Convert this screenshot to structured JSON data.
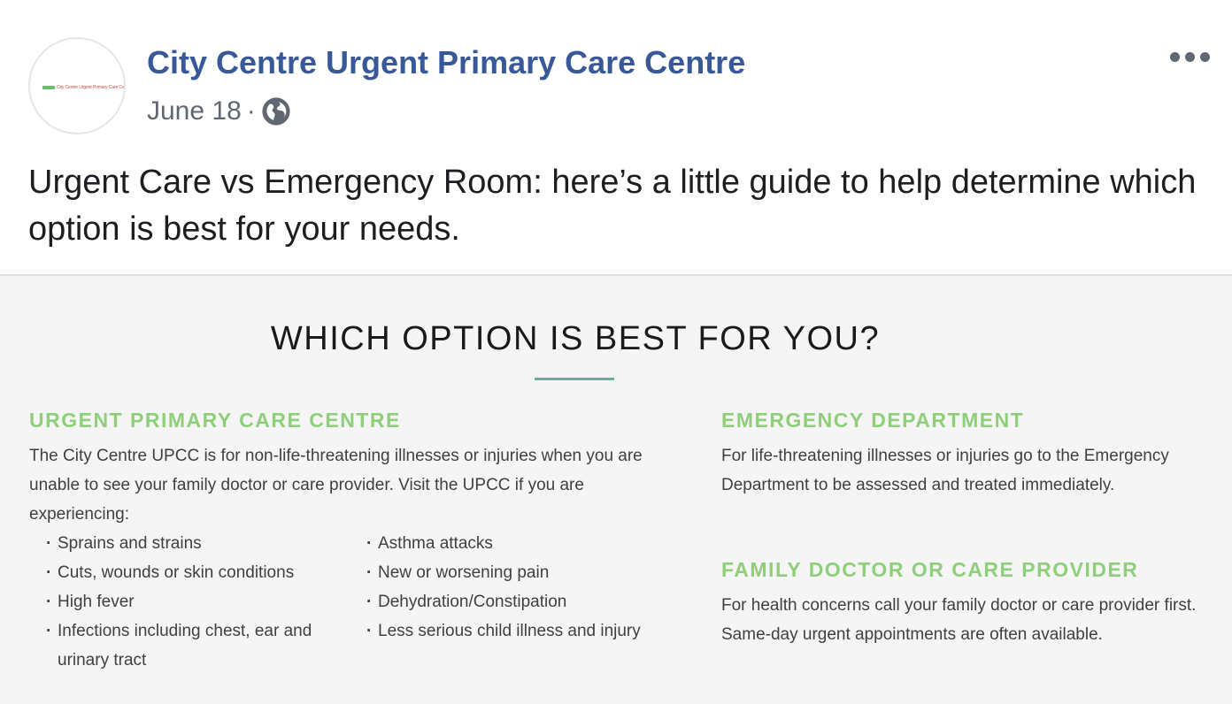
{
  "post": {
    "page_name": "City Centre Urgent Primary Care Centre",
    "avatar_text": "City Centre Urgent Primary Care Centre",
    "date": "June 18",
    "separator": "·",
    "privacy_icon": "globe-icon",
    "more_icon": "ellipsis-icon",
    "caption": "Urgent Care vs Emergency Room: here’s a little guide to help determine which option is best for your needs."
  },
  "infographic": {
    "title": "WHICH OPTION IS BEST FOR YOU?",
    "upcc": {
      "heading": "URGENT PRIMARY CARE CENTRE",
      "body": "The City Centre UPCC is for non-life-threatening illnesses or injuries when you are unable to see your family doctor or care provider. Visit the UPCC if you are experiencing:",
      "bullets_left": [
        "Sprains and strains",
        "Cuts, wounds or skin conditions",
        "High fever",
        "Infections including chest, ear and urinary tract"
      ],
      "bullets_right": [
        "Asthma attacks",
        "New or worsening pain",
        "Dehydration/Constipation",
        "Less serious child illness and injury"
      ]
    },
    "emergency": {
      "heading": "EMERGENCY DEPARTMENT",
      "body": "For life-threatening illnesses or injuries go to the Emergency Department to be assessed and treated immediately."
    },
    "family_doctor": {
      "heading": "FAMILY DOCTOR OR CARE PROVIDER",
      "body": "For health concerns call your family doctor or care provider first. Same-day urgent appointments are often available."
    }
  },
  "colors": {
    "page_name": "#385898",
    "heading_green": "#8fcf7c",
    "title_rule": "#5fb4a0",
    "infographic_bg": "#f5f5f5"
  }
}
